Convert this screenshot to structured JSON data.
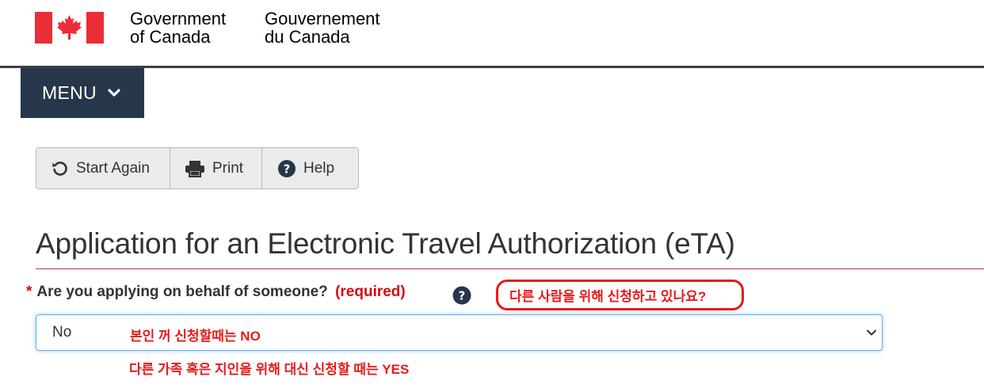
{
  "header": {
    "gov_en_line1": "Government",
    "gov_en_line2": "of Canada",
    "gov_fr_line1": "Gouvernement",
    "gov_fr_line2": "du Canada"
  },
  "menu": {
    "label": "MENU"
  },
  "toolbar": {
    "start_again": "Start Again",
    "print": "Print",
    "help": "Help"
  },
  "page": {
    "title": "Application for an Electronic Travel Authorization (eTA)"
  },
  "question": {
    "asterisk": "*",
    "label": "Are you applying on behalf of someone?",
    "required": "(required)",
    "selected_value": "No"
  },
  "annotations": {
    "question_translation": "다른 사람을 위해 신청하고 있나요?",
    "no_note": "본인 꺼 신청할때는 NO",
    "yes_note": "다른 가족 혹은 지인을 위해 대신 신청할 때는 YES"
  },
  "colors": {
    "menu_bg": "#26374a",
    "required_red": "#d3080c",
    "annotation_red": "#e81a1a",
    "title_rule": "#af3c43",
    "flag_red": "#eb2d37"
  }
}
